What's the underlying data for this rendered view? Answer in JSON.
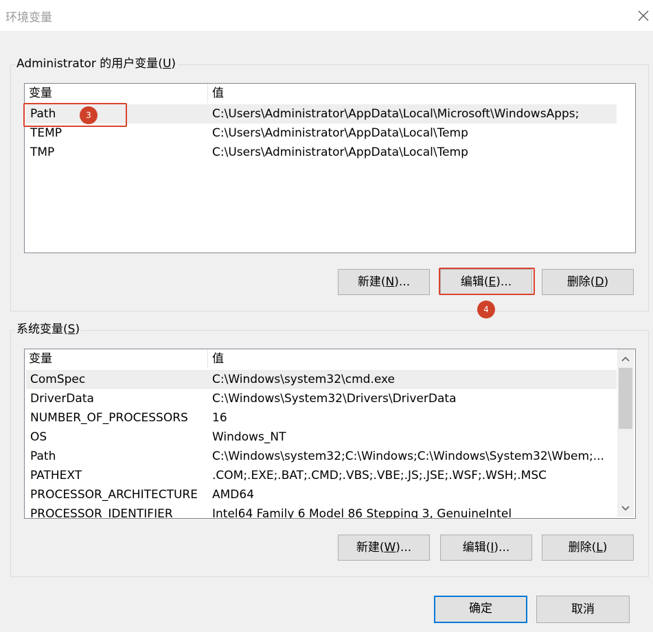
{
  "window": {
    "title": "环境变量",
    "close_icon": "close-icon"
  },
  "user_vars": {
    "group_label_prefix": "Administrator 的用户变量(",
    "group_label_key": "U",
    "group_label_suffix": ")",
    "headers": {
      "name": "变量",
      "value": "值"
    },
    "rows": [
      {
        "name": "Path",
        "value": "C:\\Users\\Administrator\\AppData\\Local\\Microsoft\\WindowsApps;"
      },
      {
        "name": "TEMP",
        "value": "C:\\Users\\Administrator\\AppData\\Local\\Temp"
      },
      {
        "name": "TMP",
        "value": "C:\\Users\\Administrator\\AppData\\Local\\Temp"
      }
    ],
    "buttons": {
      "new": {
        "prefix": "新建(",
        "key": "N",
        "suffix": ")..."
      },
      "edit": {
        "prefix": "编辑(",
        "key": "E",
        "suffix": ")..."
      },
      "delete": {
        "prefix": "删除(",
        "key": "D",
        "suffix": ")"
      }
    }
  },
  "system_vars": {
    "group_label_prefix": "系统变量(",
    "group_label_key": "S",
    "group_label_suffix": ")",
    "headers": {
      "name": "变量",
      "value": "值"
    },
    "rows": [
      {
        "name": "ComSpec",
        "value": "C:\\Windows\\system32\\cmd.exe"
      },
      {
        "name": "DriverData",
        "value": "C:\\Windows\\System32\\Drivers\\DriverData"
      },
      {
        "name": "NUMBER_OF_PROCESSORS",
        "value": "16"
      },
      {
        "name": "OS",
        "value": "Windows_NT"
      },
      {
        "name": "Path",
        "value": "C:\\Windows\\system32;C:\\Windows;C:\\Windows\\System32\\Wbem;..."
      },
      {
        "name": "PATHEXT",
        "value": ".COM;.EXE;.BAT;.CMD;.VBS;.VBE;.JS;.JSE;.WSF;.WSH;.MSC"
      },
      {
        "name": "PROCESSOR_ARCHITECTURE",
        "value": "AMD64"
      },
      {
        "name": "PROCESSOR_IDENTIFIER",
        "value": "Intel64 Family 6 Model 86 Stepping 3, GenuineIntel"
      }
    ],
    "buttons": {
      "new": {
        "prefix": "新建(",
        "key": "W",
        "suffix": ")..."
      },
      "edit": {
        "prefix": "编辑(",
        "key": "I",
        "suffix": ")..."
      },
      "delete": {
        "prefix": "删除(",
        "key": "L",
        "suffix": ")"
      }
    }
  },
  "footer": {
    "ok_label": "确定",
    "cancel_label": "取消"
  },
  "annotations": {
    "step3": "3",
    "step4": "4",
    "highlight_color": "#d9432f"
  }
}
